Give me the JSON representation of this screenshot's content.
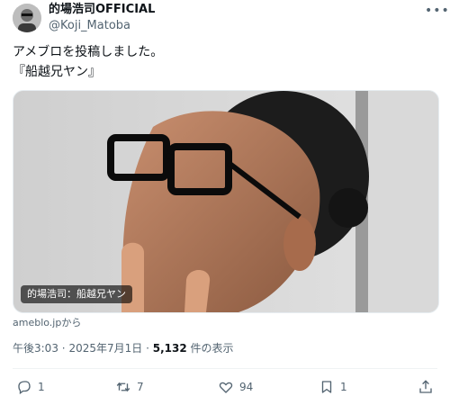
{
  "author": {
    "display_name": "的場浩司OFFICIAL",
    "handle": "@Koji_Matoba"
  },
  "post": {
    "text_line_1": "アメブロを投稿しました。",
    "text_line_2": "『船越兄ヤン』",
    "media_caption": "的場浩司：船越兄ヤン",
    "source": "ameblo.jpから",
    "time": "午後3:03",
    "separator": "·",
    "date": "2025年7月1日",
    "views_count": "5,132",
    "views_label": "件の表示"
  },
  "actions": {
    "replies": "1",
    "reposts": "7",
    "likes": "94",
    "bookmarks": "1"
  },
  "icons": [
    "avatar-photo",
    "more-icon",
    "reply-icon",
    "repost-icon",
    "like-icon",
    "bookmark-icon",
    "share-icon"
  ],
  "colors": {
    "text": "#0f1419",
    "secondary": "#536471",
    "divider": "#eff3f4"
  }
}
